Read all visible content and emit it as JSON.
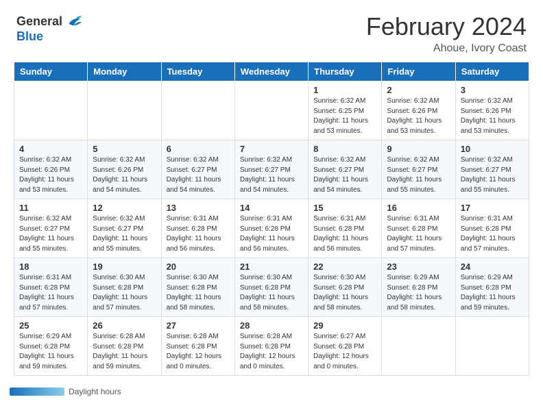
{
  "logo": {
    "general": "General",
    "blue": "Blue"
  },
  "title": "February 2024",
  "subtitle": "Ahoue, Ivory Coast",
  "days_of_week": [
    "Sunday",
    "Monday",
    "Tuesday",
    "Wednesday",
    "Thursday",
    "Friday",
    "Saturday"
  ],
  "weeks": [
    [
      {
        "day": "",
        "info": ""
      },
      {
        "day": "",
        "info": ""
      },
      {
        "day": "",
        "info": ""
      },
      {
        "day": "",
        "info": ""
      },
      {
        "day": "1",
        "info": "Sunrise: 6:32 AM\nSunset: 6:25 PM\nDaylight: 11 hours and 53 minutes."
      },
      {
        "day": "2",
        "info": "Sunrise: 6:32 AM\nSunset: 6:26 PM\nDaylight: 11 hours and 53 minutes."
      },
      {
        "day": "3",
        "info": "Sunrise: 6:32 AM\nSunset: 6:26 PM\nDaylight: 11 hours and 53 minutes."
      }
    ],
    [
      {
        "day": "4",
        "info": "Sunrise: 6:32 AM\nSunset: 6:26 PM\nDaylight: 11 hours and 53 minutes."
      },
      {
        "day": "5",
        "info": "Sunrise: 6:32 AM\nSunset: 6:26 PM\nDaylight: 11 hours and 54 minutes."
      },
      {
        "day": "6",
        "info": "Sunrise: 6:32 AM\nSunset: 6:27 PM\nDaylight: 11 hours and 54 minutes."
      },
      {
        "day": "7",
        "info": "Sunrise: 6:32 AM\nSunset: 6:27 PM\nDaylight: 11 hours and 54 minutes."
      },
      {
        "day": "8",
        "info": "Sunrise: 6:32 AM\nSunset: 6:27 PM\nDaylight: 11 hours and 54 minutes."
      },
      {
        "day": "9",
        "info": "Sunrise: 6:32 AM\nSunset: 6:27 PM\nDaylight: 11 hours and 55 minutes."
      },
      {
        "day": "10",
        "info": "Sunrise: 6:32 AM\nSunset: 6:27 PM\nDaylight: 11 hours and 55 minutes."
      }
    ],
    [
      {
        "day": "11",
        "info": "Sunrise: 6:32 AM\nSunset: 6:27 PM\nDaylight: 11 hours and 55 minutes."
      },
      {
        "day": "12",
        "info": "Sunrise: 6:32 AM\nSunset: 6:27 PM\nDaylight: 11 hours and 55 minutes."
      },
      {
        "day": "13",
        "info": "Sunrise: 6:31 AM\nSunset: 6:28 PM\nDaylight: 11 hours and 56 minutes."
      },
      {
        "day": "14",
        "info": "Sunrise: 6:31 AM\nSunset: 6:28 PM\nDaylight: 11 hours and 56 minutes."
      },
      {
        "day": "15",
        "info": "Sunrise: 6:31 AM\nSunset: 6:28 PM\nDaylight: 11 hours and 56 minutes."
      },
      {
        "day": "16",
        "info": "Sunrise: 6:31 AM\nSunset: 6:28 PM\nDaylight: 11 hours and 57 minutes."
      },
      {
        "day": "17",
        "info": "Sunrise: 6:31 AM\nSunset: 6:28 PM\nDaylight: 11 hours and 57 minutes."
      }
    ],
    [
      {
        "day": "18",
        "info": "Sunrise: 6:31 AM\nSunset: 6:28 PM\nDaylight: 11 hours and 57 minutes."
      },
      {
        "day": "19",
        "info": "Sunrise: 6:30 AM\nSunset: 6:28 PM\nDaylight: 11 hours and 57 minutes."
      },
      {
        "day": "20",
        "info": "Sunrise: 6:30 AM\nSunset: 6:28 PM\nDaylight: 11 hours and 58 minutes."
      },
      {
        "day": "21",
        "info": "Sunrise: 6:30 AM\nSunset: 6:28 PM\nDaylight: 11 hours and 58 minutes."
      },
      {
        "day": "22",
        "info": "Sunrise: 6:30 AM\nSunset: 6:28 PM\nDaylight: 11 hours and 58 minutes."
      },
      {
        "day": "23",
        "info": "Sunrise: 6:29 AM\nSunset: 6:28 PM\nDaylight: 11 hours and 58 minutes."
      },
      {
        "day": "24",
        "info": "Sunrise: 6:29 AM\nSunset: 6:28 PM\nDaylight: 11 hours and 59 minutes."
      }
    ],
    [
      {
        "day": "25",
        "info": "Sunrise: 6:29 AM\nSunset: 6:28 PM\nDaylight: 11 hours and 59 minutes."
      },
      {
        "day": "26",
        "info": "Sunrise: 6:28 AM\nSunset: 6:28 PM\nDaylight: 11 hours and 59 minutes."
      },
      {
        "day": "27",
        "info": "Sunrise: 6:28 AM\nSunset: 6:28 PM\nDaylight: 12 hours and 0 minutes."
      },
      {
        "day": "28",
        "info": "Sunrise: 6:28 AM\nSunset: 6:28 PM\nDaylight: 12 hours and 0 minutes."
      },
      {
        "day": "29",
        "info": "Sunrise: 6:27 AM\nSunset: 6:28 PM\nDaylight: 12 hours and 0 minutes."
      },
      {
        "day": "",
        "info": ""
      },
      {
        "day": "",
        "info": ""
      }
    ]
  ],
  "footer": {
    "daylight_label": "Daylight hours"
  }
}
